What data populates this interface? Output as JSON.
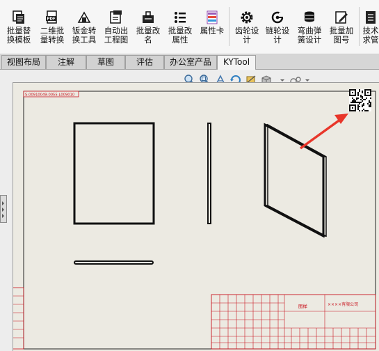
{
  "ribbon": {
    "buttons": [
      {
        "label": "批量替\n换模板",
        "icon": "template-replace-icon"
      },
      {
        "label": "二维批\n量转换",
        "icon": "pdf-convert-icon"
      },
      {
        "label": "钣金转\n换工具",
        "icon": "sheetmetal-icon"
      },
      {
        "label": "自动出\n工程图",
        "icon": "drawing-icon"
      },
      {
        "label": "批量改\n名",
        "icon": "rename-icon"
      },
      {
        "label": "批量改\n属性",
        "icon": "property-list-icon"
      },
      {
        "label": "属性卡",
        "icon": "property-card-icon"
      },
      {
        "label": "齿轮设\n计",
        "icon": "gear-icon"
      },
      {
        "label": "链轮设\n计",
        "icon": "sprocket-icon"
      },
      {
        "label": "弯曲弹\n簧设计",
        "icon": "spring-icon"
      },
      {
        "label": "批量加\n图号",
        "icon": "drawing-number-icon"
      },
      {
        "label": "技术\n求管",
        "icon": "requirements-icon"
      }
    ]
  },
  "tabs": [
    {
      "label": "视图布局",
      "active": false
    },
    {
      "label": "注解",
      "active": false
    },
    {
      "label": "草图",
      "active": false
    },
    {
      "label": "评估",
      "active": false
    },
    {
      "label": "办公室产品",
      "active": false
    },
    {
      "label": "KYTool",
      "active": true
    }
  ],
  "sheet": {
    "code_label": "S-00910049-0055-L009010",
    "title_block": {
      "drawing_name": "图样",
      "company": "××××有限公司"
    }
  },
  "colors": {
    "sheet_bg": "#eceae2",
    "title_block_red": "#c8141e",
    "arrow": "#e8362a",
    "rename_icon": "#1a1a1a",
    "property_card_icon": "#9b59b6"
  }
}
